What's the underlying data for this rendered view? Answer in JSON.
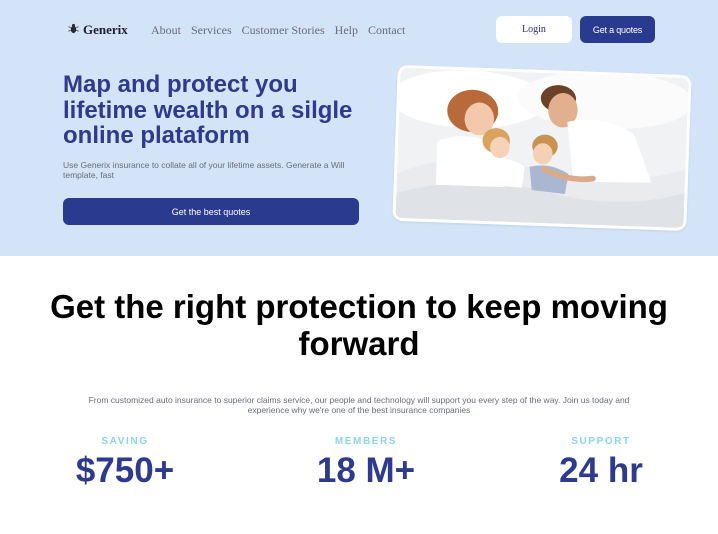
{
  "brand": {
    "name": "Generix",
    "icon": "beetle-logo-icon"
  },
  "nav": {
    "links": [
      "About",
      "Services",
      "Customer Stories",
      "Help",
      "Contact"
    ]
  },
  "header": {
    "login_label": "Login",
    "quotes_label": "Get a quotes"
  },
  "hero": {
    "title": "Map and protect you lifetime wealth on a silgle online plataform",
    "subtitle": "Use Generix insurance to collate all of your lifetime assets. Generate a Will template, fast",
    "cta_label": "Get the best quotes",
    "image": "family-in-bed-photo"
  },
  "section": {
    "title": "Get the right protection to keep moving forward",
    "subtitle": "From customized auto insurance to superior claims service, our people and technology will support you every step of the way. Join us today and experience why we're one of the best insurance companies"
  },
  "stats": [
    {
      "label": "SAVING",
      "value": "$750+"
    },
    {
      "label": "MEMBERS",
      "value": "18 M+"
    },
    {
      "label": "SUPPORT",
      "value": "24 hr"
    }
  ],
  "colors": {
    "hero_bg": "#d3e3f8",
    "primary": "#2a3a8f",
    "heading": "#2e3a8c",
    "accent": "#8fd3e6"
  }
}
